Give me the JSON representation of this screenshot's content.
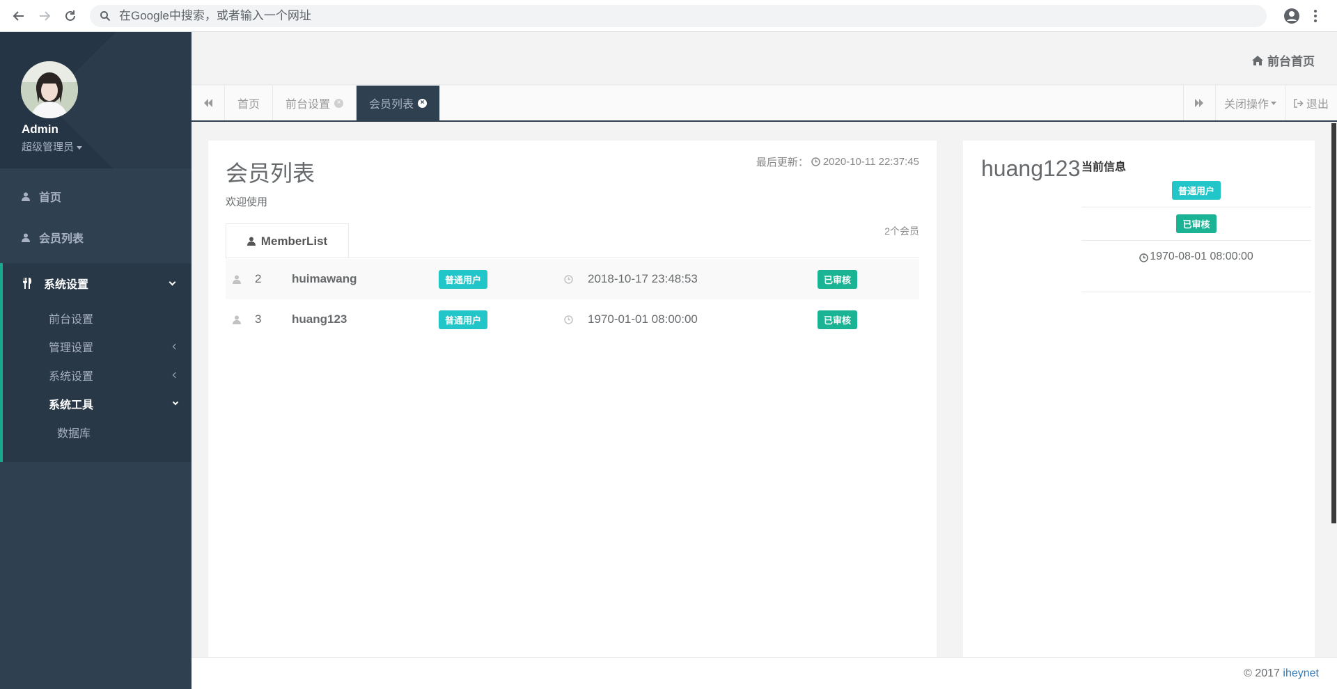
{
  "browser": {
    "omnibox_placeholder": "在Google中搜索，或者输入一个网址"
  },
  "sidebar": {
    "user_name": "Admin",
    "user_role": "超级管理员",
    "items": [
      {
        "label": "首页",
        "icon": "user-icon"
      },
      {
        "label": "会员列表",
        "icon": "user-icon"
      },
      {
        "label": "系统设置",
        "icon": "cutlery-icon"
      }
    ],
    "sub_items": [
      {
        "label": "前台设置"
      },
      {
        "label": "管理设置"
      },
      {
        "label": "系统设置"
      },
      {
        "label": "系统工具"
      }
    ],
    "sub_sub_items": [
      {
        "label": "数据库"
      }
    ]
  },
  "header": {
    "front_link": "前台首页"
  },
  "tabs": {
    "items": [
      {
        "label": "首页",
        "closable": false
      },
      {
        "label": "前台设置",
        "closable": true
      },
      {
        "label": "会员列表",
        "closable": true,
        "active": true
      }
    ],
    "close_ops": "关闭操作",
    "logout": "退出"
  },
  "main": {
    "title": "会员列表",
    "subtitle": "欢迎使用",
    "last_update_label": "最后更新：",
    "last_update_time": "2020-10-11 22:37:45",
    "count": "2个会员",
    "list_tab": "MemberList",
    "rows": [
      {
        "id": "2",
        "name": "huimawang",
        "type": "普通用户",
        "date": "2018-10-17 23:48:53",
        "status": "已审核"
      },
      {
        "id": "3",
        "name": "huang123",
        "type": "普通用户",
        "date": "1970-01-01 08:00:00",
        "status": "已审核"
      }
    ]
  },
  "side": {
    "name": "huang123",
    "title": "当前信息",
    "type": "普通用户",
    "status": "已审核",
    "date": "1970-08-01 08:00:00"
  },
  "footer": {
    "copyright": "© 2017 ",
    "brand": "iheynet"
  },
  "colors": {
    "sidebar_bg": "#2f4050",
    "accent_green": "#1ab394",
    "accent_cyan": "#23c6c8"
  }
}
